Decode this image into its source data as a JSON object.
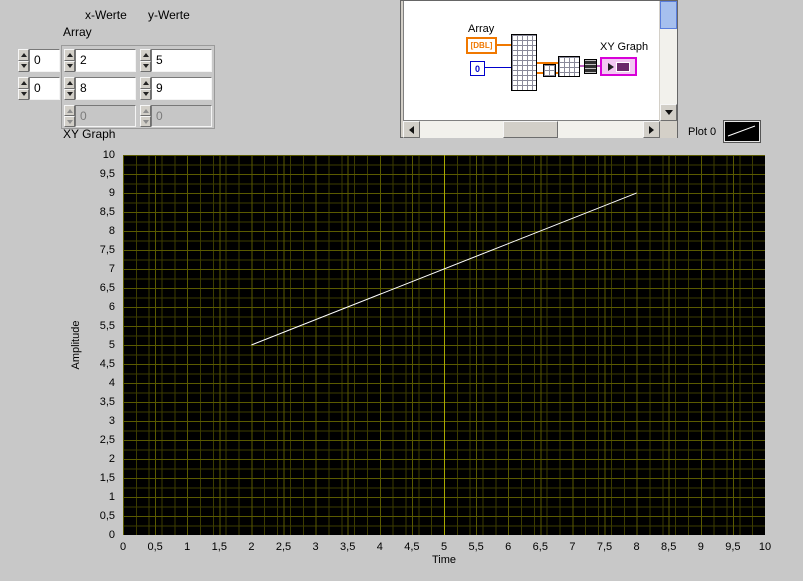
{
  "front_panel": {
    "column_labels": {
      "x": "x-Werte",
      "y": "y-Werte"
    },
    "array_label": "Array",
    "graph_label": "XY Graph",
    "index_values": [
      "0",
      "0"
    ],
    "x_values": [
      "2",
      "8",
      "0"
    ],
    "y_values": [
      "5",
      "9",
      "0"
    ]
  },
  "block_diagram": {
    "array_label": "Array",
    "dbl_terminal_label": "[DBL]",
    "constant_value": "0",
    "xy_graph_label": "XY Graph"
  },
  "graph": {
    "legend_label": "Plot 0",
    "x_axis_label": "Time",
    "y_axis_label": "Amplitude",
    "y_tick_labels": [
      "10",
      "9,5",
      "9",
      "8,5",
      "8",
      "7,5",
      "7",
      "6,5",
      "6",
      "5,5",
      "5",
      "4,5",
      "4",
      "3,5",
      "3",
      "2,5",
      "2",
      "1,5",
      "1",
      "0,5",
      "0"
    ],
    "x_tick_labels": [
      "0",
      "0,5",
      "1",
      "1,5",
      "2",
      "2,5",
      "3",
      "3,5",
      "4",
      "4,5",
      "5",
      "5,5",
      "6",
      "6,5",
      "7",
      "7,5",
      "8",
      "8,5",
      "9",
      "9,5",
      "10"
    ],
    "colors": {
      "plot_bg": "#000000",
      "grid_minor": "#3c3c00",
      "grid_major": "#5a5a00",
      "grid_center": "#a8a800",
      "line": "#ffffff"
    }
  },
  "chart_data": {
    "type": "line",
    "title": "XY Graph",
    "xlabel": "Time",
    "ylabel": "Amplitude",
    "xlim": [
      0,
      10
    ],
    "ylim": [
      0,
      10
    ],
    "series": [
      {
        "name": "Plot 0",
        "x": [
          2,
          8
        ],
        "y": [
          5,
          9
        ]
      }
    ],
    "grid": true,
    "legend_position": "top-right"
  }
}
